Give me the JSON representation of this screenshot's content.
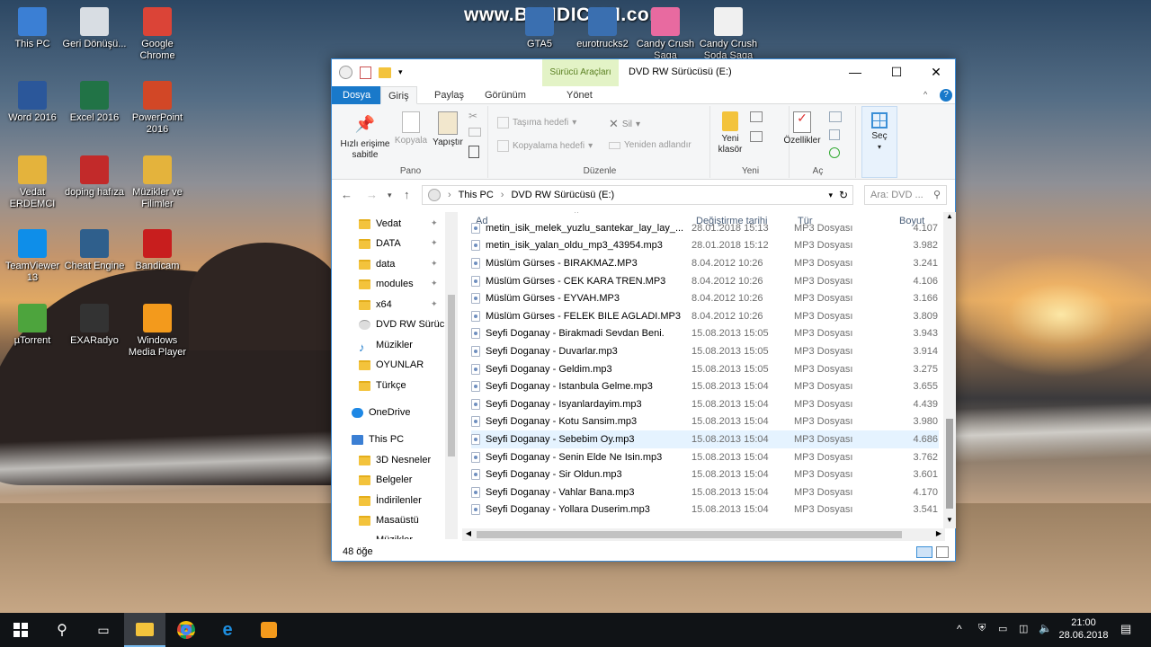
{
  "watermark": "www.BANDICAM.com",
  "desktop_icons": [
    {
      "label": "This PC",
      "color": "#3b7fd4"
    },
    {
      "label": "Geri Dönüşü...",
      "color": "#d8dde3"
    },
    {
      "label": "Google Chrome",
      "color": "#db4437"
    },
    {
      "label": "Word 2016",
      "color": "#2b579a"
    },
    {
      "label": "Excel 2016",
      "color": "#217346"
    },
    {
      "label": "PowerPoint 2016",
      "color": "#d24726"
    },
    {
      "label": "Vedat ERDEMCI",
      "color": "#e4b33c"
    },
    {
      "label": "doping hafıza",
      "color": "#c22a2a"
    },
    {
      "label": "Müzikler ve Filimler",
      "color": "#e4b33c"
    },
    {
      "label": "TeamViewer 13",
      "color": "#0e8ee9"
    },
    {
      "label": "Cheat Engine",
      "color": "#2f5f8c"
    },
    {
      "label": "Bandicam",
      "color": "#c81e1e"
    },
    {
      "label": "µTorrent",
      "color": "#4da43d"
    },
    {
      "label": "EXARadyo",
      "color": "#333333"
    },
    {
      "label": "Windows Media Player",
      "color": "#f39a1c"
    },
    {
      "label": "GTA5",
      "color": "#3a6fb0"
    },
    {
      "label": "eurotrucks2",
      "color": "#3a6fb0"
    },
    {
      "label": "Candy Crush Saga",
      "color": "#e86aa0"
    },
    {
      "label": "Candy Crush Soda Saga",
      "color": "#f0f0f0"
    }
  ],
  "window": {
    "title": "DVD RW Sürücüsü (E:)",
    "context_tab": "Sürücü Araçları",
    "tabs": {
      "file": "Dosya",
      "home": "Giriş",
      "share": "Paylaş",
      "view": "Görünüm",
      "manage": "Yönet"
    },
    "ribbon": {
      "pin": "Hızlı erişime sabitle",
      "copy": "Kopyala",
      "paste": "Yapıştır",
      "group_clipboard": "Pano",
      "move_to": "Taşıma hedefi",
      "copy_to": "Kopyalama hedefi",
      "delete": "Sil",
      "rename": "Yeniden adlandır",
      "group_organize": "Düzenle",
      "new_folder": "Yeni klasör",
      "group_new": "Yeni",
      "properties": "Özellikler",
      "group_open": "Aç",
      "select": "Seç"
    },
    "address": {
      "segments": [
        "This PC",
        "DVD RW Sürücüsü (E:)"
      ],
      "search_placeholder": "Ara: DVD ..."
    },
    "nav": [
      {
        "label": "Vedat",
        "pinned": true
      },
      {
        "label": "DATA",
        "pinned": true
      },
      {
        "label": "data",
        "pinned": true
      },
      {
        "label": "modules",
        "pinned": true
      },
      {
        "label": "x64",
        "pinned": true
      },
      {
        "label": "DVD RW Sürücü",
        "pinned": false
      },
      {
        "label": "Müzikler",
        "pinned": false
      },
      {
        "label": "OYUNLAR",
        "pinned": false
      },
      {
        "label": "Türkçe",
        "pinned": false
      },
      {
        "label": "OneDrive",
        "pinned": false
      },
      {
        "label": "This PC",
        "pinned": false
      },
      {
        "label": "3D Nesneler",
        "pinned": false
      },
      {
        "label": "Belgeler",
        "pinned": false
      },
      {
        "label": "İndirilenler",
        "pinned": false
      },
      {
        "label": "Masaüstü",
        "pinned": false
      },
      {
        "label": "Müzikler",
        "pinned": false
      }
    ],
    "columns": {
      "name": "Ad",
      "date": "Değiştirme tarihi",
      "type": "Tür",
      "size": "Boyut"
    },
    "files": [
      {
        "name": "metin_isik_melek_yuzlu_santekar_lay_lay_...",
        "date": "28.01.2018 15:13",
        "type": "MP3 Dosyası",
        "size": "4.107"
      },
      {
        "name": "metin_isik_yalan_oldu_mp3_43954.mp3",
        "date": "28.01.2018 15:12",
        "type": "MP3 Dosyası",
        "size": "3.982"
      },
      {
        "name": "Müslüm Gürses - BIRAKMAZ.MP3",
        "date": "8.04.2012 10:26",
        "type": "MP3 Dosyası",
        "size": "3.241"
      },
      {
        "name": "Müslüm Gürses - CEK  KARA  TREN.MP3",
        "date": "8.04.2012 10:26",
        "type": "MP3 Dosyası",
        "size": "4.106"
      },
      {
        "name": "Müslüm Gürses - EYVAH.MP3",
        "date": "8.04.2012 10:26",
        "type": "MP3 Dosyası",
        "size": "3.166"
      },
      {
        "name": "Müslüm Gürses - FELEK  BILE  AGLADI.MP3",
        "date": "8.04.2012 10:26",
        "type": "MP3 Dosyası",
        "size": "3.809"
      },
      {
        "name": "Seyfi Doganay - Birakmadi Sevdan Beni.",
        "date": "15.08.2013 15:05",
        "type": "MP3 Dosyası",
        "size": "3.943"
      },
      {
        "name": "Seyfi Doganay - Duvarlar.mp3",
        "date": "15.08.2013 15:05",
        "type": "MP3 Dosyası",
        "size": "3.914"
      },
      {
        "name": "Seyfi Doganay - Geldim.mp3",
        "date": "15.08.2013 15:05",
        "type": "MP3 Dosyası",
        "size": "3.275"
      },
      {
        "name": "Seyfi Doganay - Istanbula Gelme.mp3",
        "date": "15.08.2013 15:04",
        "type": "MP3 Dosyası",
        "size": "3.655"
      },
      {
        "name": "Seyfi Doganay - Isyanlardayim.mp3",
        "date": "15.08.2013 15:04",
        "type": "MP3 Dosyası",
        "size": "4.439"
      },
      {
        "name": "Seyfi Doganay - Kotu Sansim.mp3",
        "date": "15.08.2013 15:04",
        "type": "MP3 Dosyası",
        "size": "3.980"
      },
      {
        "name": "Seyfi Doganay - Sebebim Oy.mp3",
        "date": "15.08.2013 15:04",
        "type": "MP3 Dosyası",
        "size": "4.686",
        "selected": true
      },
      {
        "name": "Seyfi Doganay - Senin Elde Ne Isin.mp3",
        "date": "15.08.2013 15:04",
        "type": "MP3 Dosyası",
        "size": "3.762"
      },
      {
        "name": "Seyfi Doganay - Sir Oldun.mp3",
        "date": "15.08.2013 15:04",
        "type": "MP3 Dosyası",
        "size": "3.601"
      },
      {
        "name": "Seyfi Doganay - Vahlar Bana.mp3",
        "date": "15.08.2013 15:04",
        "type": "MP3 Dosyası",
        "size": "4.170"
      },
      {
        "name": "Seyfi Doganay - Yollara Duserim.mp3",
        "date": "15.08.2013 15:04",
        "type": "MP3 Dosyası",
        "size": "3.541"
      }
    ],
    "status": "48 öğe"
  },
  "taskbar": {
    "time": "21:00",
    "date": "28.06.2018"
  }
}
